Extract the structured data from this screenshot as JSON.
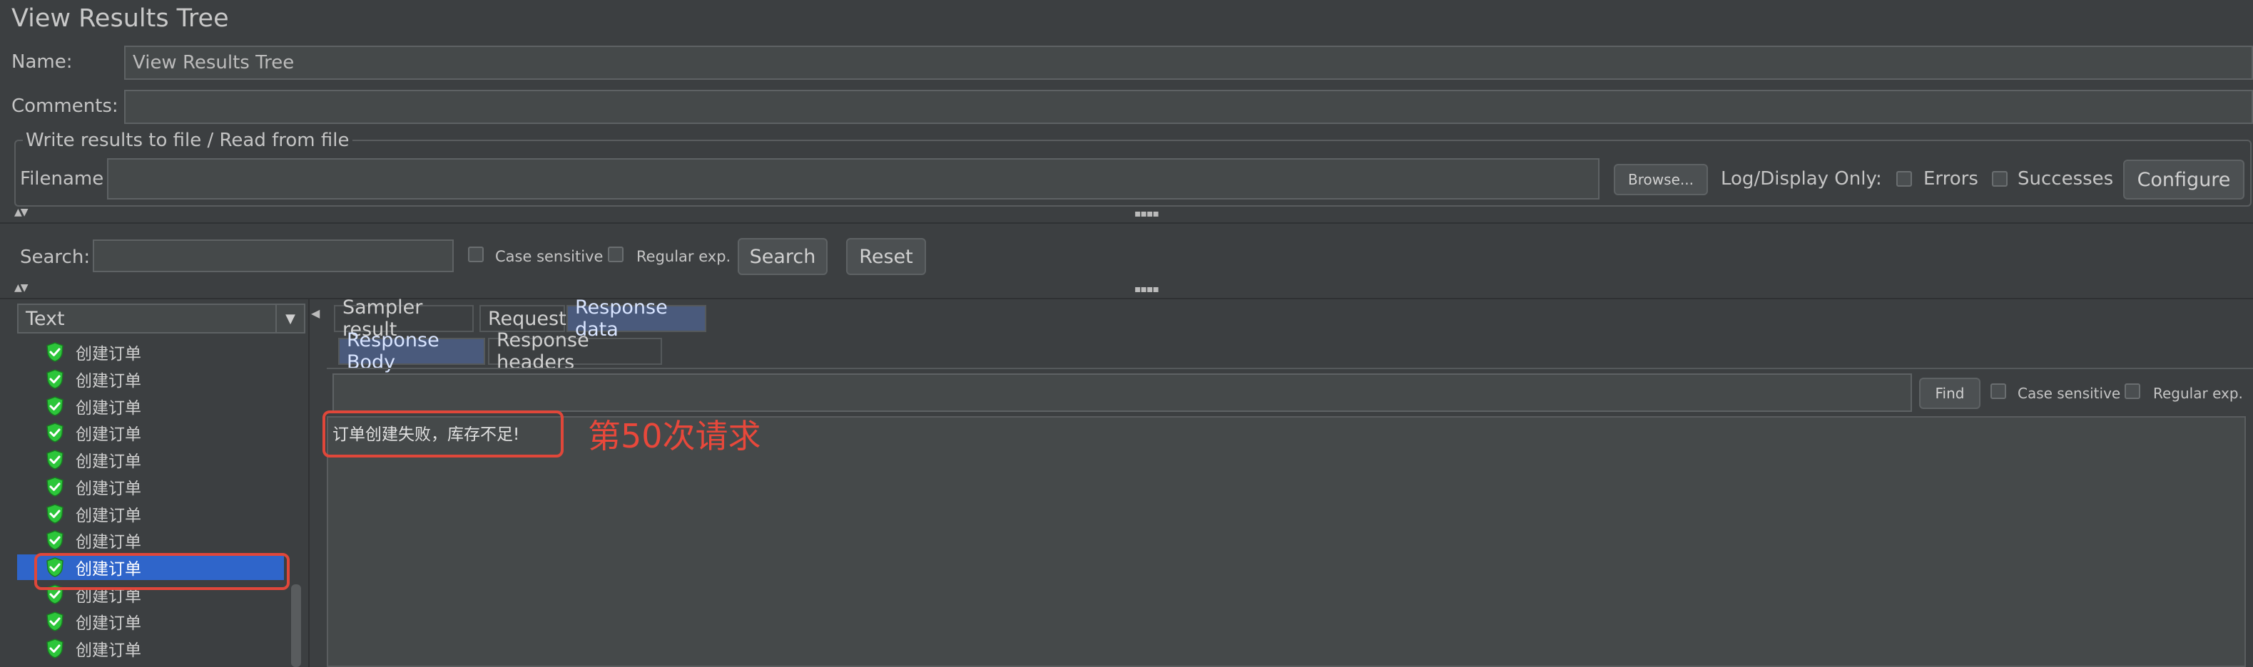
{
  "window": {
    "title": "View Results Tree"
  },
  "form": {
    "name_label": "Name:",
    "name_value": "View Results Tree",
    "comments_label": "Comments:",
    "comments_value": ""
  },
  "file_group": {
    "title": "Write results to file / Read from file",
    "filename_label": "Filename",
    "filename_value": "",
    "browse_label": "Browse...",
    "log_display_label": "Log/Display Only:",
    "errors_label": "Errors",
    "successes_label": "Successes",
    "configure_label": "Configure"
  },
  "search": {
    "label": "Search:",
    "value": "",
    "case_sensitive_label": "Case sensitive",
    "regex_label": "Regular exp.",
    "search_button": "Search",
    "reset_button": "Reset"
  },
  "renderer": {
    "selected": "Text"
  },
  "tree": {
    "items": [
      "创建订单",
      "创建订单",
      "创建订单",
      "创建订单",
      "创建订单",
      "创建订单",
      "创建订单",
      "创建订单",
      "创建订单",
      "创建订单",
      "创建订单",
      "创建订单"
    ],
    "selected_index": 8
  },
  "tabs": [
    {
      "label": "Sampler result",
      "active": false
    },
    {
      "label": "Request",
      "active": false
    },
    {
      "label": "Response data",
      "active": true
    }
  ],
  "subtabs": [
    {
      "label": "Response Body",
      "active": true
    },
    {
      "label": "Response headers",
      "active": false
    }
  ],
  "find": {
    "value": "",
    "find_button": "Find",
    "case_sensitive_label": "Case sensitive",
    "regex_label": "Regular exp."
  },
  "response": {
    "body": "订单创建失败，库存不足!"
  },
  "annotation": {
    "text": "第50次请求"
  },
  "colors": {
    "selection": "#2f65ca",
    "annotation": "#e8483b",
    "success_icon": "#2cc63a"
  }
}
